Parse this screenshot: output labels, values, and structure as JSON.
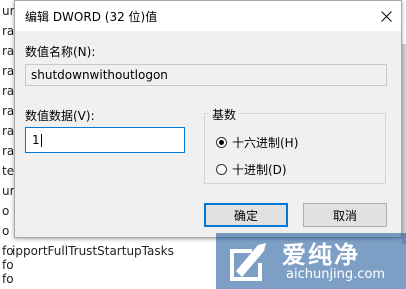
{
  "background": {
    "fragments": [
      "ur",
      "ra",
      "ra",
      "ra",
      "ra",
      "ra",
      "ra",
      "ra",
      "te",
      "ur",
      "o",
      "o",
      "fo",
      "fo",
      "fo"
    ],
    "bottom_row": "ipportFullTrustStartupTasks"
  },
  "dialog": {
    "title": "编辑 DWORD (32 位)值",
    "close_icon": "close-icon",
    "name_label": "数值名称(N):",
    "name_value": "shutdownwithoutlogon",
    "data_label": "数值数据(V):",
    "data_value": "1",
    "base_group_label": "基数",
    "radio_hex": "十六进制(H)",
    "radio_dec": "十进制(D)",
    "radio_selected": "hex",
    "ok_label": "确定",
    "cancel_label": "取消"
  },
  "watermark": {
    "brand": "爱纯净",
    "url": "aichunjing.com",
    "color": "#1450a0"
  }
}
